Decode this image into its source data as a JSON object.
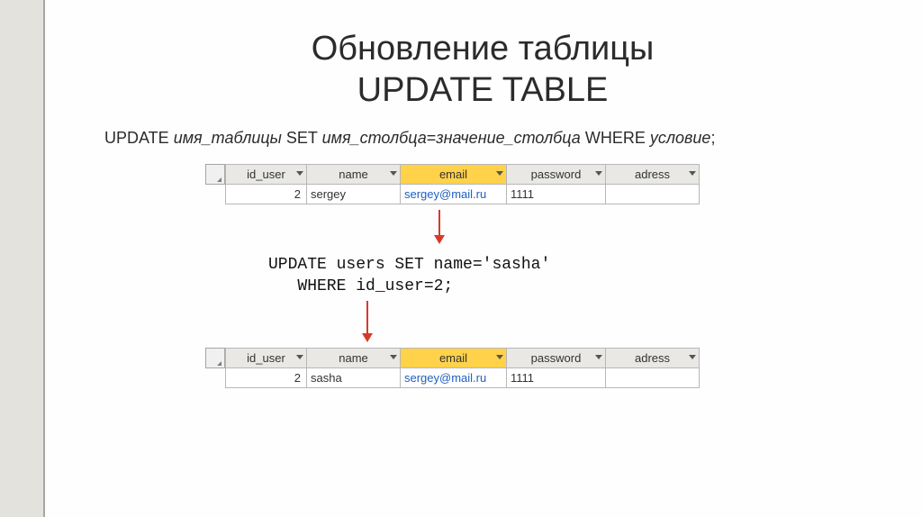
{
  "title_line1": "Обновление таблицы",
  "title_line2": "UPDATE TABLE",
  "syntax": {
    "kw_update": "UPDATE ",
    "it_table": "имя_таблицы",
    "kw_set": " SET ",
    "it_col": "имя_столбца",
    "eq": "=",
    "it_val": "значение_столбца",
    "kw_where": " WHERE ",
    "it_cond": "условие",
    "semi": ";"
  },
  "columns": {
    "id": "id_user",
    "name": "name",
    "email": "email",
    "password": "password",
    "adress": "adress"
  },
  "row_before": {
    "id": "2",
    "name": "sergey",
    "email": "sergey@mail.ru",
    "password": "1111",
    "adress": ""
  },
  "sql": {
    "line1": "UPDATE users SET name='sasha'",
    "line2": "   WHERE id_user=2;"
  },
  "row_after": {
    "id": "2",
    "name": "sasha",
    "email": "sergey@mail.ru",
    "password": "1111",
    "adress": ""
  },
  "colors": {
    "highlight": "#ffd24a",
    "arrow": "#d83a2a"
  }
}
